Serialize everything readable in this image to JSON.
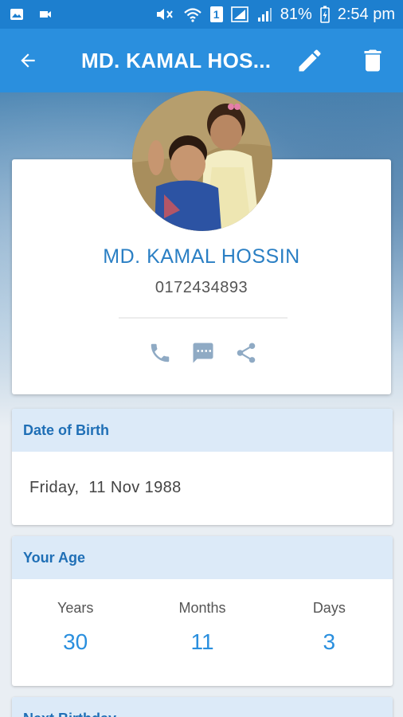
{
  "status_bar": {
    "battery": "81%",
    "time": "2:54 pm",
    "sim_label": "1"
  },
  "app_bar": {
    "title": "MD. KAMAL HOS...",
    "back_icon": "arrow-back-icon",
    "edit_icon": "pencil-icon",
    "delete_icon": "trash-icon"
  },
  "profile": {
    "name": "MD. KAMAL HOSSIN",
    "phone": "0172434893",
    "actions": [
      "phone-icon",
      "message-icon",
      "share-icon"
    ]
  },
  "date_of_birth": {
    "header": "Date of Birth",
    "value": "Friday,  11 Nov 1988"
  },
  "age": {
    "header": "Your Age",
    "columns": [
      {
        "label": "Years",
        "value": "30"
      },
      {
        "label": "Months",
        "value": "11"
      },
      {
        "label": "Days",
        "value": "3"
      }
    ]
  },
  "next_birthday": {
    "header": "Next Birthday"
  },
  "colors": {
    "primary": "#2a8fde",
    "status_bar": "#1d7fcf",
    "header_tint": "#dceaf8",
    "accent_text": "#2a7fc4"
  }
}
